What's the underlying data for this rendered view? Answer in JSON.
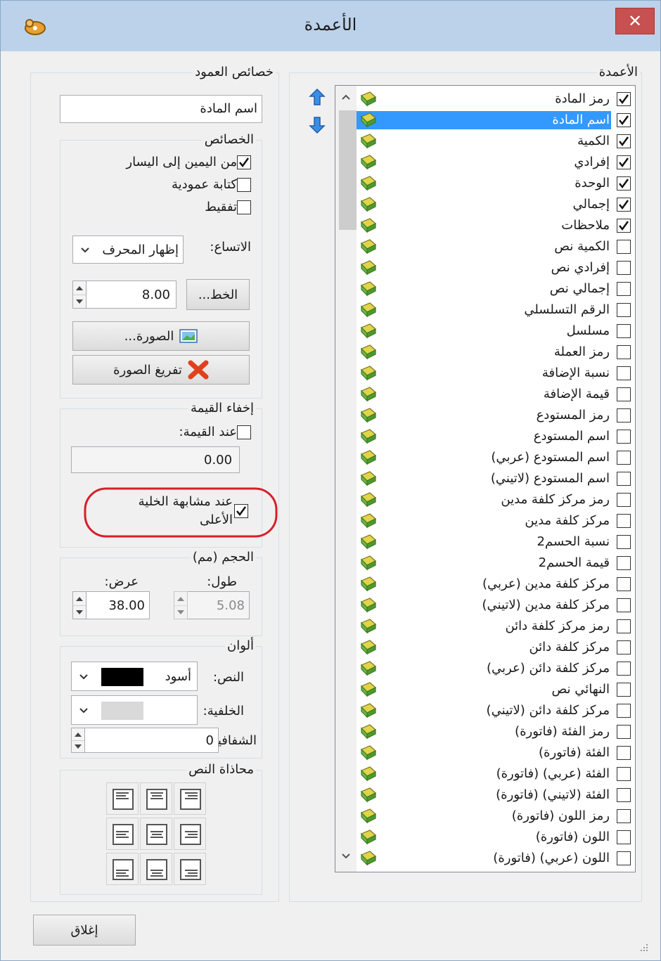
{
  "window": {
    "title": "الأعمدة",
    "close_glyph": "✕",
    "accent_color": "#c75050",
    "titlebar_color": "#bcd2ea"
  },
  "columns_group": {
    "legend": "الأعمدة",
    "items": [
      {
        "label": "رمز المادة",
        "checked": true
      },
      {
        "label": "اسم المادة",
        "checked": true,
        "selected": true
      },
      {
        "label": "الكمية",
        "checked": true
      },
      {
        "label": "إفرادي",
        "checked": true
      },
      {
        "label": "الوحدة",
        "checked": true
      },
      {
        "label": "إجمالي",
        "checked": true
      },
      {
        "label": "ملاحظات",
        "checked": true
      },
      {
        "label": "الكمية نص",
        "checked": false
      },
      {
        "label": "إفرادي نص",
        "checked": false
      },
      {
        "label": "إجمالي نص",
        "checked": false
      },
      {
        "label": "الرقم التسلسلي",
        "checked": false
      },
      {
        "label": "مسلسل",
        "checked": false
      },
      {
        "label": "رمز العملة",
        "checked": false
      },
      {
        "label": "نسبة الإضافة",
        "checked": false
      },
      {
        "label": "قيمة الإضافة",
        "checked": false
      },
      {
        "label": "رمز المستودع",
        "checked": false
      },
      {
        "label": "اسم المستودع",
        "checked": false
      },
      {
        "label": "اسم المستودع (عربي)",
        "checked": false
      },
      {
        "label": "اسم المستودع (لاتيني)",
        "checked": false
      },
      {
        "label": "رمز مركز كلفة مدين",
        "checked": false
      },
      {
        "label": "مركز كلفة مدين",
        "checked": false
      },
      {
        "label": "نسبة الحسم2",
        "checked": false
      },
      {
        "label": "قيمة الحسم2",
        "checked": false
      },
      {
        "label": "مركز كلفة مدين (عربي)",
        "checked": false
      },
      {
        "label": "مركز كلفة مدين (لاتيني)",
        "checked": false
      },
      {
        "label": "رمز مركز كلفة دائن",
        "checked": false
      },
      {
        "label": "مركز كلفة دائن",
        "checked": false
      },
      {
        "label": "مركز كلفة دائن (عربي)",
        "checked": false
      },
      {
        "label": "النهائي نص",
        "checked": false
      },
      {
        "label": "مركز كلفة دائن (لاتيني)",
        "checked": false
      },
      {
        "label": "رمز الفئة (فاتورة)",
        "checked": false
      },
      {
        "label": "الفئة (فاتورة)",
        "checked": false
      },
      {
        "label": "الفئة (عربي) (فاتورة)",
        "checked": false
      },
      {
        "label": "الفئة (لاتيني) (فاتورة)",
        "checked": false
      },
      {
        "label": "رمز اللون (فاتورة)",
        "checked": false
      },
      {
        "label": "اللون (فاتورة)",
        "checked": false
      },
      {
        "label": "اللون (عربي) (فاتورة)",
        "checked": false
      }
    ]
  },
  "props_group": {
    "legend": "خصائص العمود",
    "column_name": "اسم المادة",
    "properties": {
      "legend": "الخصائص",
      "rtl_label": "من اليمين إلى اليسار",
      "rtl_checked": true,
      "vertical_label": "كتابة عمودية",
      "vertical_checked": false,
      "dotted_label": "تفقيط",
      "dotted_checked": false,
      "overflow_label": "الاتساع:",
      "overflow_value": "إظهار المحرف",
      "font_button": "الخط...",
      "font_size": "8.00",
      "image_button": "الصورة...",
      "clear_image_button": "تفريغ الصورة"
    },
    "hide_value": {
      "legend": "إخفاء القيمة",
      "on_value_label": "عند القيمة:",
      "on_value_checked": false,
      "value": "0.00",
      "similar_label_1": "عند مشابهة الخلية",
      "similar_label_2": "الأعلى",
      "similar_checked": true,
      "highlight_color": "#d81e2a"
    },
    "size": {
      "legend": "الحجم (مم)",
      "length_label": "طول:",
      "length_value": "5.08",
      "width_label": "عرض:",
      "width_value": "38.00"
    },
    "colors": {
      "legend": "ألوان",
      "text_label": "النص:",
      "text_color_name": "أسود",
      "text_swatch": "#000000",
      "background_label": "الخلفية:",
      "background_swatch": "#d9d9d9",
      "opacity_label": "الشفافية",
      "opacity_value": "0"
    },
    "alignment": {
      "legend": "محاذاة النص"
    }
  },
  "footer": {
    "close_button": "إغلاق"
  }
}
